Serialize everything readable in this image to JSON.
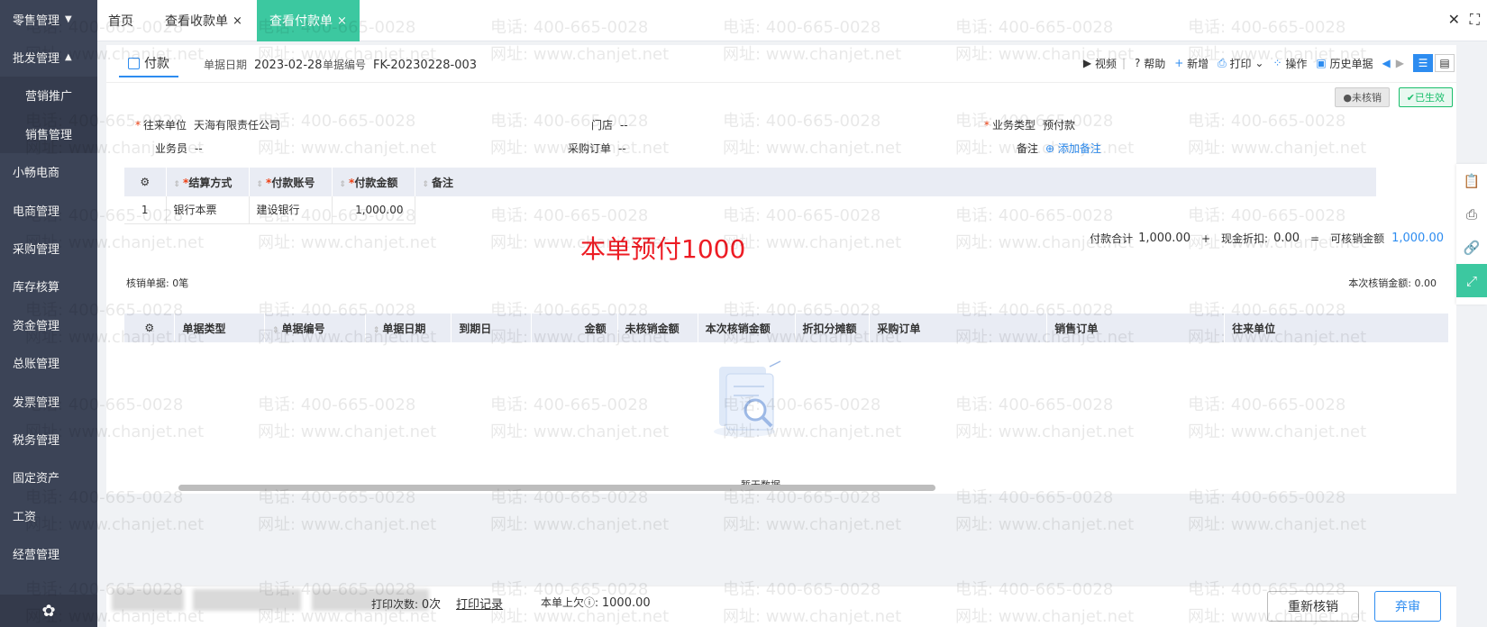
{
  "sidebar": {
    "items": [
      {
        "label": "零售管理",
        "caret": "▼"
      },
      {
        "label": "批发管理",
        "caret": "▲"
      },
      {
        "label": "营销推广",
        "sub": true
      },
      {
        "label": "销售管理",
        "sub": true
      },
      {
        "label": "小畅电商"
      },
      {
        "label": "电商管理"
      },
      {
        "label": "采购管理"
      },
      {
        "label": "库存核算"
      },
      {
        "label": "资金管理"
      },
      {
        "label": "总账管理"
      },
      {
        "label": "发票管理"
      },
      {
        "label": "税务管理"
      },
      {
        "label": "固定资产"
      },
      {
        "label": "工资"
      },
      {
        "label": "经营管理"
      }
    ],
    "gear": "✿"
  },
  "tabs": {
    "home": "首页",
    "tab1": "查看收款单",
    "tab2": "查看付款单",
    "close": "×",
    "win_close": "✕",
    "win_max": "⛶"
  },
  "doc": {
    "type": "付款",
    "date_label": "单据日期",
    "date": "2023-02-28",
    "no_label": "单据编号",
    "no": "FK-20230228-003"
  },
  "tools": {
    "video": "视频",
    "help": "帮助",
    "add": "新增",
    "print": "打印",
    "ops": "操作",
    "history": "历史单据"
  },
  "status": {
    "unverified": "未核销",
    "effective": "已生效"
  },
  "form": {
    "partner_label": "往来单位",
    "partner": "天海有限责任公司",
    "store_label": "门店",
    "store": "--",
    "biz_type_label": "业务类型",
    "biz_type": "预付款",
    "clerk_label": "业务员",
    "clerk": "--",
    "po_label": "采购订单",
    "po": "--",
    "remark_label": "备注",
    "remark_add": "添加备注"
  },
  "pay_table": {
    "headers": [
      "结算方式",
      "付款账号",
      "付款金额",
      "备注"
    ],
    "rows": [
      {
        "idx": "1",
        "method": "银行本票",
        "account": "建设银行",
        "amount": "1,000.00",
        "note": ""
      }
    ]
  },
  "annotation": "本单预付1000",
  "summary": {
    "total_label": "付款合计",
    "total": "1,000.00",
    "plus": "+",
    "discount_label": "现金折扣:",
    "discount": "0.00",
    "eq": "=",
    "verifiable_label": "可核销金额",
    "verifiable": "1,000.00"
  },
  "verify": {
    "count_label": "核销单据: 0笔",
    "this_label": "本次核销金额: 0.00",
    "headers": [
      "单据类型",
      "单据编号",
      "单据日期",
      "到期日",
      "金额",
      "未核销金额",
      "本次核销金额",
      "折扣分摊额",
      "采购订单",
      "销售订单",
      "往来单位"
    ],
    "empty": "暂无数据"
  },
  "footer": {
    "print_count_label": "打印次数:",
    "print_count": "0次",
    "print_log": "打印记录",
    "last_owed_label": "本单上欠",
    "last_owed": "1000.00",
    "reverify": "重新核销",
    "abandon": "弃审"
  },
  "watermark": {
    "phone": "电话: 400-665-0028",
    "site": "网址: www.chanjet.net"
  }
}
